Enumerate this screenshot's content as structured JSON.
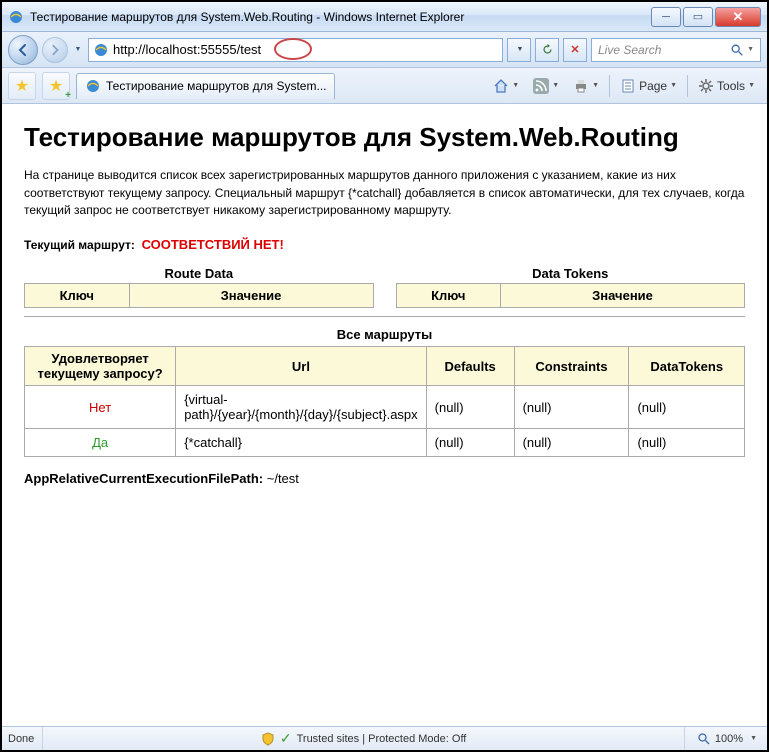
{
  "window": {
    "title": "Тестирование маршрутов для System.Web.Routing - Windows Internet Explorer"
  },
  "nav": {
    "url": "http://localhost:55555/test",
    "search_placeholder": "Live Search"
  },
  "tab": {
    "title": "Тестирование маршрутов для System..."
  },
  "toolbar": {
    "page_label": "Page",
    "tools_label": "Tools"
  },
  "page": {
    "heading": "Тестирование маршрутов для System.Web.Routing",
    "description": "На странице выводится список всех зарегистрированных маршрутов данного приложения с указанием, какие из них соответствуют текущему запросу. Специальный маршрут {*catchall} добавляется в список автоматически, для тех случаев, когда текущий запрос не соответствует никакому зарегистрированному маршруту.",
    "current_route_label": "Текущий маршрут",
    "no_match": "СООТВЕТСТВИЙ НЕТ!",
    "route_data_caption": "Route Data",
    "data_tokens_caption": "Data Tokens",
    "col_key": "Ключ",
    "col_value": "Значение",
    "all_routes_caption": "Все маршруты",
    "col_match": "Удовлетворяет текущему запросу?",
    "col_url": "Url",
    "col_defaults": "Defaults",
    "col_constraints": "Constraints",
    "col_datatokens": "DataTokens",
    "routes": [
      {
        "match": "Нет",
        "match_ok": false,
        "url": "{virtual-path}/{year}/{month}/{day}/{subject}.aspx",
        "defaults": "(null)",
        "constraints": "(null)",
        "datatokens": "(null)"
      },
      {
        "match": "Да",
        "match_ok": true,
        "url": "{*catchall}",
        "defaults": "(null)",
        "constraints": "(null)",
        "datatokens": "(null)"
      }
    ],
    "app_path_label": "AppRelativeCurrentExecutionFilePath",
    "app_path_value": "~/test"
  },
  "statusbar": {
    "done": "Done",
    "security": "Trusted sites | Protected Mode: Off",
    "zoom": "100%"
  }
}
